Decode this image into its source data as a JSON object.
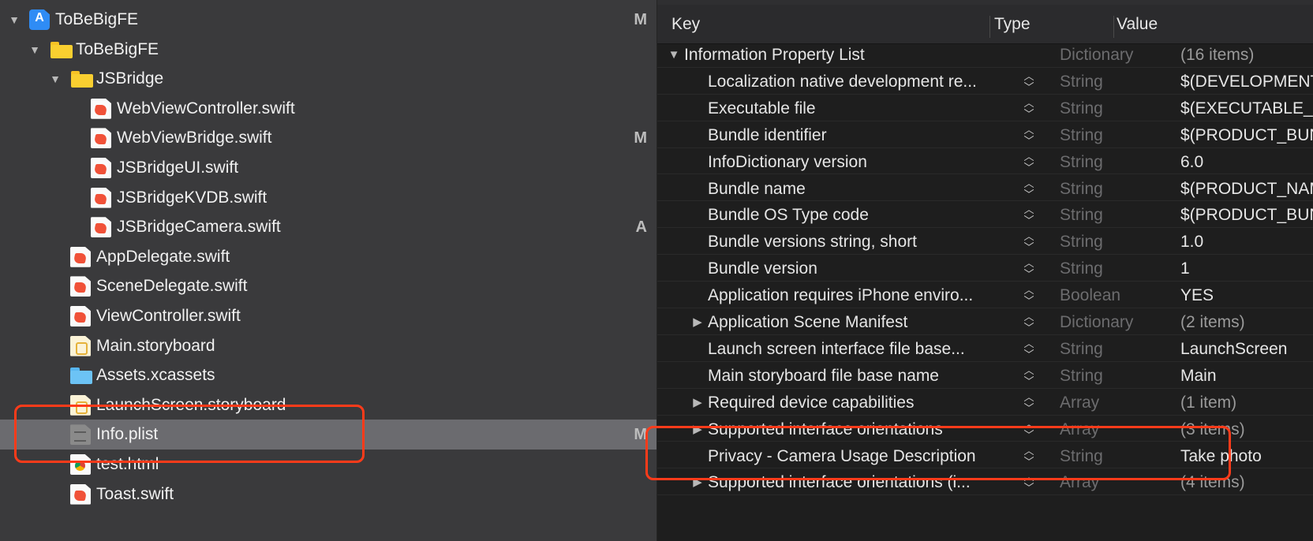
{
  "navigator": {
    "items": [
      {
        "label": "ToBeBigFE",
        "icon": "project-icon",
        "badge": "M",
        "disclosure": "open",
        "level": 0,
        "selected": false
      },
      {
        "label": "ToBeBigFE",
        "icon": "folder-icon",
        "badge": "",
        "disclosure": "open",
        "level": 1,
        "selected": false
      },
      {
        "label": "JSBridge",
        "icon": "folder-icon",
        "badge": "",
        "disclosure": "open",
        "level": 2,
        "selected": false
      },
      {
        "label": "WebViewController.swift",
        "icon": "swift-file-icon",
        "badge": "",
        "disclosure": "none",
        "level": 3,
        "selected": false
      },
      {
        "label": "WebViewBridge.swift",
        "icon": "swift-file-icon",
        "badge": "M",
        "disclosure": "none",
        "level": 3,
        "selected": false
      },
      {
        "label": "JSBridgeUI.swift",
        "icon": "swift-file-icon",
        "badge": "",
        "disclosure": "none",
        "level": 3,
        "selected": false
      },
      {
        "label": "JSBridgeKVDB.swift",
        "icon": "swift-file-icon",
        "badge": "",
        "disclosure": "none",
        "level": 3,
        "selected": false
      },
      {
        "label": "JSBridgeCamera.swift",
        "icon": "swift-file-icon",
        "badge": "A",
        "disclosure": "none",
        "level": 3,
        "selected": false
      },
      {
        "label": "AppDelegate.swift",
        "icon": "swift-file-icon",
        "badge": "",
        "disclosure": "none",
        "level": 2,
        "selected": false
      },
      {
        "label": "SceneDelegate.swift",
        "icon": "swift-file-icon",
        "badge": "",
        "disclosure": "none",
        "level": 2,
        "selected": false
      },
      {
        "label": "ViewController.swift",
        "icon": "swift-file-icon",
        "badge": "",
        "disclosure": "none",
        "level": 2,
        "selected": false
      },
      {
        "label": "Main.storyboard",
        "icon": "storyboard-icon",
        "badge": "",
        "disclosure": "none",
        "level": 2,
        "selected": false
      },
      {
        "label": "Assets.xcassets",
        "icon": "assets-icon",
        "badge": "",
        "disclosure": "none",
        "level": 2,
        "selected": false
      },
      {
        "label": "LaunchScreen.storyboard",
        "icon": "storyboard-icon",
        "badge": "",
        "disclosure": "none",
        "level": 2,
        "selected": false
      },
      {
        "label": "Info.plist",
        "icon": "plist-file-icon",
        "badge": "M",
        "disclosure": "none",
        "level": 2,
        "selected": true
      },
      {
        "label": "test.html",
        "icon": "html-file-icon",
        "badge": "",
        "disclosure": "none",
        "level": 2,
        "selected": false
      },
      {
        "label": "Toast.swift",
        "icon": "swift-file-icon",
        "badge": "",
        "disclosure": "none",
        "level": 2,
        "selected": false
      }
    ]
  },
  "plist": {
    "header": {
      "key": "Key",
      "type": "Type",
      "value": "Value"
    },
    "rows": [
      {
        "key": "Information Property List",
        "type": "Dictionary",
        "value": "(16 items)",
        "disclosure": "open",
        "level": 0,
        "stepper": false,
        "value_dim": true
      },
      {
        "key": "Localization native development re...",
        "type": "String",
        "value": "$(DEVELOPMENT_LANGUAGE)",
        "disclosure": "none",
        "level": 1,
        "stepper": true,
        "value_dim": false
      },
      {
        "key": "Executable file",
        "type": "String",
        "value": "$(EXECUTABLE_NAME)",
        "disclosure": "none",
        "level": 1,
        "stepper": true,
        "value_dim": false
      },
      {
        "key": "Bundle identifier",
        "type": "String",
        "value": "$(PRODUCT_BUNDLE_IDENTIFIER)",
        "disclosure": "none",
        "level": 1,
        "stepper": true,
        "value_dim": false
      },
      {
        "key": "InfoDictionary version",
        "type": "String",
        "value": "6.0",
        "disclosure": "none",
        "level": 1,
        "stepper": true,
        "value_dim": false
      },
      {
        "key": "Bundle name",
        "type": "String",
        "value": "$(PRODUCT_NAME)",
        "disclosure": "none",
        "level": 1,
        "stepper": true,
        "value_dim": false
      },
      {
        "key": "Bundle OS Type code",
        "type": "String",
        "value": "$(PRODUCT_BUNDLE_PACKAGE_TYPE)",
        "disclosure": "none",
        "level": 1,
        "stepper": true,
        "value_dim": false
      },
      {
        "key": "Bundle versions string, short",
        "type": "String",
        "value": "1.0",
        "disclosure": "none",
        "level": 1,
        "stepper": true,
        "value_dim": false
      },
      {
        "key": "Bundle version",
        "type": "String",
        "value": "1",
        "disclosure": "none",
        "level": 1,
        "stepper": true,
        "value_dim": false
      },
      {
        "key": "Application requires iPhone enviro...",
        "type": "Boolean",
        "value": "YES",
        "disclosure": "none",
        "level": 1,
        "stepper": true,
        "value_dim": false
      },
      {
        "key": "Application Scene Manifest",
        "type": "Dictionary",
        "value": "(2 items)",
        "disclosure": "closed",
        "level": 1,
        "stepper": true,
        "value_dim": true
      },
      {
        "key": "Launch screen interface file base...",
        "type": "String",
        "value": "LaunchScreen",
        "disclosure": "none",
        "level": 1,
        "stepper": true,
        "value_dim": false
      },
      {
        "key": "Main storyboard file base name",
        "type": "String",
        "value": "Main",
        "disclosure": "none",
        "level": 1,
        "stepper": true,
        "value_dim": false
      },
      {
        "key": "Required device capabilities",
        "type": "Array",
        "value": "(1 item)",
        "disclosure": "closed",
        "level": 1,
        "stepper": true,
        "value_dim": true
      },
      {
        "key": "Supported interface orientations",
        "type": "Array",
        "value": "(3 items)",
        "disclosure": "closed",
        "level": 1,
        "stepper": true,
        "value_dim": true
      },
      {
        "key": "Privacy - Camera Usage Description",
        "type": "String",
        "value": "Take photo",
        "disclosure": "none",
        "level": 1,
        "stepper": true,
        "value_dim": false
      },
      {
        "key": "Supported interface orientations (i...",
        "type": "Array",
        "value": "(4 items)",
        "disclosure": "closed",
        "level": 1,
        "stepper": true,
        "value_dim": true
      }
    ]
  },
  "colors": {
    "highlight": "#ff3b1a",
    "navigator_bg": "#3a3a3c",
    "selected_row_bg": "#6b6b6f",
    "editor_bg": "#1e1e1e"
  }
}
